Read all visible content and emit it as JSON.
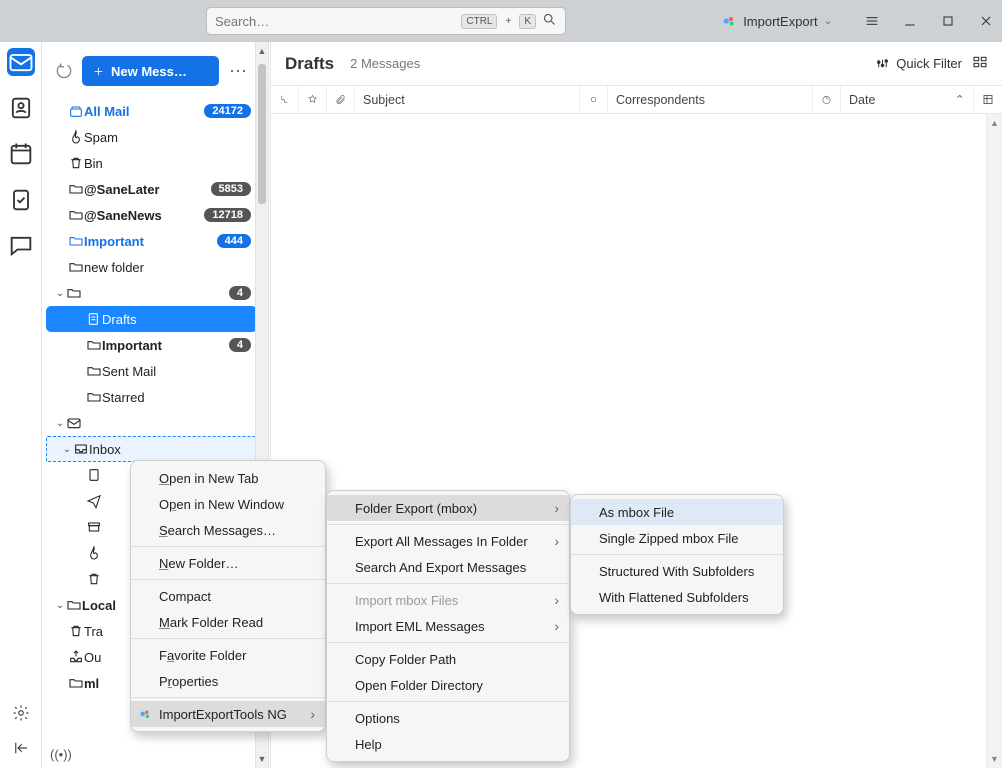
{
  "titlebar": {
    "search_placeholder": "Search…",
    "kbd_ctrl": "CTRL",
    "kbd_plus": "+",
    "kbd_k": "K",
    "import_export_label": "ImportExport"
  },
  "new_message_label": "New Mess…",
  "folders": {
    "all_mail": {
      "label": "All Mail",
      "count": "24172"
    },
    "spam": {
      "label": "Spam"
    },
    "bin": {
      "label": "Bin"
    },
    "sane_later": {
      "label": "@SaneLater",
      "count": "5853"
    },
    "sane_news": {
      "label": "@SaneNews",
      "count": "12718"
    },
    "important": {
      "label": "Important",
      "count": "444"
    },
    "new_folder": {
      "label": "new folder"
    },
    "unnamed": {
      "label": "",
      "count": "4"
    },
    "drafts": {
      "label": "Drafts"
    },
    "important2": {
      "label": "Important",
      "count": "4"
    },
    "sent_mail": {
      "label": "Sent Mail"
    },
    "starred": {
      "label": "Starred"
    },
    "inbox": {
      "label": "Inbox"
    },
    "local": {
      "label": "Local"
    },
    "tr": {
      "label": "Tra"
    },
    "ou": {
      "label": "Ou"
    },
    "ml": {
      "label": "ml"
    }
  },
  "pane": {
    "title": "Drafts",
    "count_text": "2 Messages",
    "quick_filter": "Quick Filter",
    "col_subject": "Subject",
    "col_correspondents": "Correspondents",
    "col_date": "Date"
  },
  "ctx1": {
    "open_tab": "Open in New Tab",
    "open_win": "Open in New Window",
    "search": "Search Messages…",
    "new_folder": "New Folder…",
    "compact": "Compact",
    "mark_read": "Mark Folder Read",
    "favorite": "Favorite Folder",
    "properties": "Properties",
    "iet": "ImportExportTools NG"
  },
  "ctx2": {
    "folder_export": "Folder Export (mbox)",
    "export_all": "Export All Messages In Folder",
    "search_export": "Search And Export Messages",
    "import_mbox": "Import mbox Files",
    "import_eml": "Import EML Messages",
    "copy_path": "Copy Folder Path",
    "open_dir": "Open Folder Directory",
    "options": "Options",
    "help": "Help"
  },
  "ctx3": {
    "as_mbox": "As mbox File",
    "single_zip": "Single Zipped mbox File",
    "structured": "Structured With Subfolders",
    "flattened": "With Flattened Subfolders"
  }
}
